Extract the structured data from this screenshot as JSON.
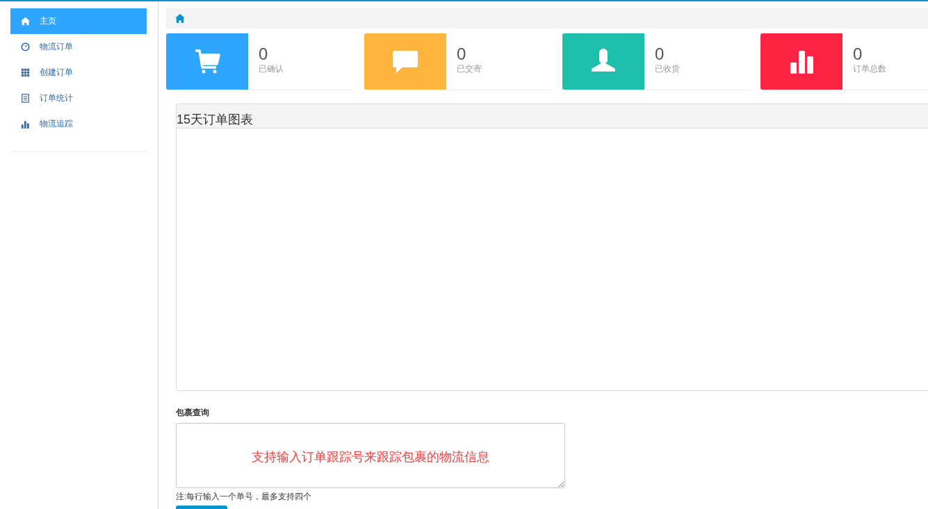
{
  "sidebar": {
    "items": [
      {
        "label": "主页",
        "kind": "home",
        "selected": true
      },
      {
        "label": "物流订单",
        "kind": "dashboard",
        "selected": false
      },
      {
        "label": "创建订单",
        "kind": "grid",
        "selected": false
      },
      {
        "label": "订单统计",
        "kind": "list",
        "selected": false
      },
      {
        "label": "物流追踪",
        "kind": "bars",
        "selected": false
      }
    ]
  },
  "stats": [
    {
      "value": "0",
      "label": "已确认",
      "kind": "cart",
      "color": "#2ea5ff"
    },
    {
      "value": "0",
      "label": "已交寄",
      "kind": "comment",
      "color": "#ffb43e"
    },
    {
      "value": "0",
      "label": "已收货",
      "kind": "user",
      "color": "#1ebfad"
    },
    {
      "value": "0",
      "label": "订单总数",
      "kind": "bars",
      "color": "#fc2442"
    }
  ],
  "chart_panel": {
    "title": "15天订单图表"
  },
  "parcel_query": {
    "label": "包裹查询",
    "placeholder": "支持输入订单跟踪号来跟踪包裹的物流信息",
    "note": "注:每行输入一个单号，最多支持四个"
  }
}
